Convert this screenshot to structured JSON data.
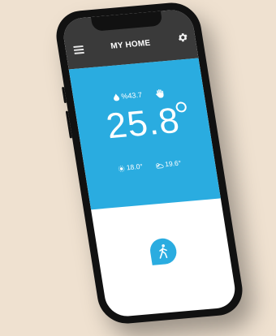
{
  "header": {
    "title": "MY HOME"
  },
  "thermostat": {
    "humidity": "%43.7",
    "temperature": "25.8",
    "set_point": "18.0",
    "outdoor": "19.6",
    "degree_symbol": "°"
  },
  "colors": {
    "accent": "#2aace0",
    "topbar": "#3a3a3a",
    "background": "#efe1d0"
  },
  "icons": [
    "menu-icon",
    "gear-icon",
    "water-drop-icon",
    "hand-icon",
    "sun-icon",
    "cloud-sun-icon",
    "walking-person-icon"
  ]
}
